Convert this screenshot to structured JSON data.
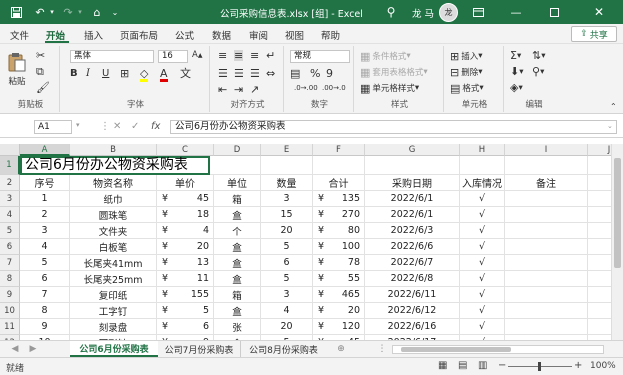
{
  "titlebar": {
    "title": "公司采购信息表.xlsx [组] - Excel",
    "user": "龙 马",
    "avatar_text": "龙",
    "icons": [
      "save-icon",
      "undo-icon",
      "redo-icon",
      "home-icon",
      "more-icon",
      "lightbulb-icon",
      "ribbon-display-icon",
      "minimize-icon",
      "maximize-icon",
      "close-icon"
    ]
  },
  "menu": {
    "items": [
      "文件",
      "开始",
      "插入",
      "页面布局",
      "公式",
      "数据",
      "审阅",
      "视图",
      "帮助"
    ],
    "active": "开始",
    "share": "共享"
  },
  "ribbon": {
    "clipboard": {
      "label": "剪贴板",
      "paste": "粘贴"
    },
    "font": {
      "label": "字体",
      "font_name": "黑体",
      "font_size": "16",
      "bold": "B",
      "italic": "I",
      "underline": "U"
    },
    "align": {
      "label": "对齐方式"
    },
    "number": {
      "label": "数字",
      "format": "常规"
    },
    "styles": {
      "label": "样式",
      "cond": "条件格式",
      "table": "套用表格格式",
      "cell": "单元格样式"
    },
    "cells": {
      "label": "单元格",
      "insert": "插入",
      "delete": "删除",
      "format": "格式"
    },
    "editing": {
      "label": "编辑"
    }
  },
  "formula": {
    "namebox": "A1",
    "content": "公司6月份办公物资采购表"
  },
  "sheet": {
    "columns": [
      "A",
      "B",
      "C",
      "D",
      "E",
      "F",
      "G",
      "H",
      "I",
      "J"
    ],
    "title": "公司6月份办公物资采购表",
    "headers": [
      "序号",
      "物资名称",
      "单价",
      "单位",
      "数量",
      "合计",
      "采购日期",
      "入库情况",
      "备注"
    ],
    "rows": [
      {
        "no": "1",
        "name": "纸巾",
        "price": "45",
        "unit": "箱",
        "qty": "3",
        "total": "135",
        "date": "2022/6/1",
        "status": "√"
      },
      {
        "no": "2",
        "name": "圆珠笔",
        "price": "18",
        "unit": "盒",
        "qty": "15",
        "total": "270",
        "date": "2022/6/1",
        "status": "√"
      },
      {
        "no": "3",
        "name": "文件夹",
        "price": "4",
        "unit": "个",
        "qty": "20",
        "total": "80",
        "date": "2022/6/3",
        "status": "√"
      },
      {
        "no": "4",
        "name": "白板笔",
        "price": "20",
        "unit": "盒",
        "qty": "5",
        "total": "100",
        "date": "2022/6/6",
        "status": "√"
      },
      {
        "no": "5",
        "name": "长尾夹41mm",
        "price": "13",
        "unit": "盒",
        "qty": "6",
        "total": "78",
        "date": "2022/6/7",
        "status": "√"
      },
      {
        "no": "6",
        "name": "长尾夹25mm",
        "price": "11",
        "unit": "盒",
        "qty": "5",
        "total": "55",
        "date": "2022/6/8",
        "status": "√"
      },
      {
        "no": "7",
        "name": "复印纸",
        "price": "155",
        "unit": "箱",
        "qty": "3",
        "total": "465",
        "date": "2022/6/11",
        "status": "√"
      },
      {
        "no": "8",
        "name": "工字钉",
        "price": "5",
        "unit": "盒",
        "qty": "4",
        "total": "20",
        "date": "2022/6/12",
        "status": "√"
      },
      {
        "no": "9",
        "name": "刻录盘",
        "price": "6",
        "unit": "张",
        "qty": "20",
        "total": "120",
        "date": "2022/6/16",
        "status": "√"
      },
      {
        "no": "10",
        "name": "回形针",
        "price": "9",
        "unit": "盒",
        "qty": "5",
        "total": "45",
        "date": "2022/6/17",
        "status": "√"
      }
    ],
    "currency": "¥",
    "row_numbers": [
      "1",
      "2",
      "3",
      "4",
      "5",
      "6",
      "7",
      "8",
      "9",
      "10",
      "11",
      "12",
      "13"
    ]
  },
  "tabs": [
    "公司6月份采购表",
    "公司7月份采购表",
    "公司8月份采购表"
  ],
  "active_tab": 0,
  "status": {
    "ready": "就绪",
    "zoom": "100%"
  }
}
